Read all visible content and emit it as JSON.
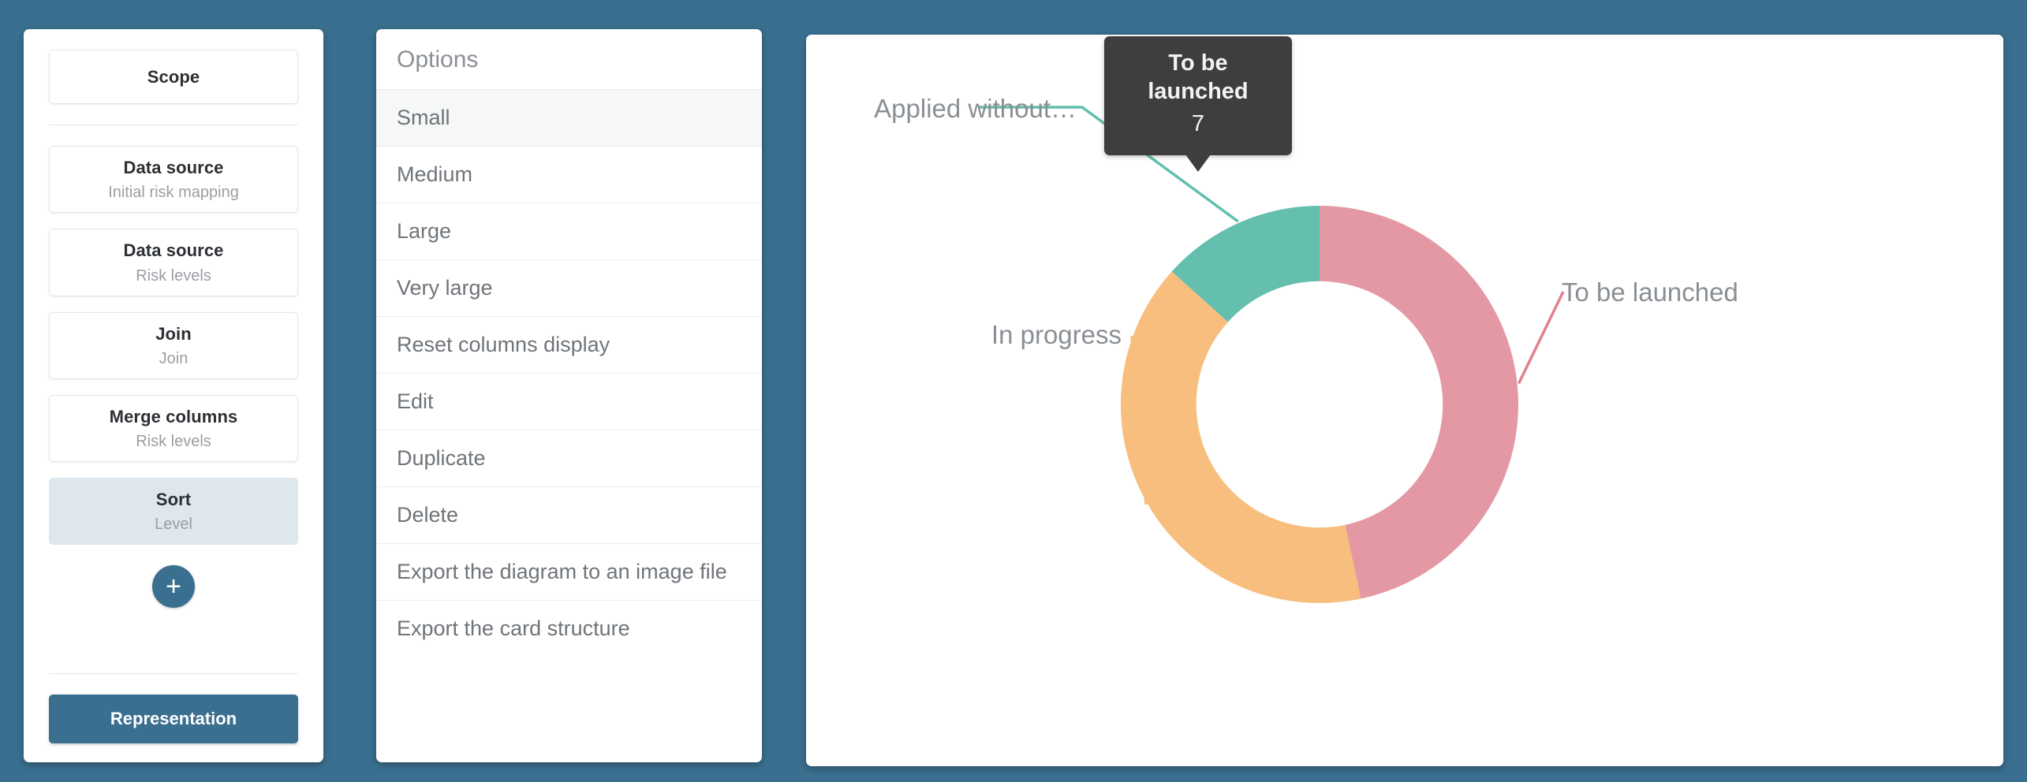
{
  "theme": {
    "background": "#3a6f8f",
    "accent": "#3a6f8f",
    "panel": "#ffffff",
    "selected_step": "#dde7ec",
    "tooltip_background": "#3e3e3e"
  },
  "pipeline": {
    "scope": {
      "title": "Scope"
    },
    "steps": [
      {
        "title": "Data source",
        "subtitle": "Initial risk mapping",
        "selected": false
      },
      {
        "title": "Data source",
        "subtitle": "Risk levels",
        "selected": false
      },
      {
        "title": "Join",
        "subtitle": "Join",
        "selected": false
      },
      {
        "title": "Merge columns",
        "subtitle": "Risk levels",
        "selected": false
      },
      {
        "title": "Sort",
        "subtitle": "Level",
        "selected": true
      }
    ],
    "add_step_label": "+",
    "representation_label": "Representation"
  },
  "options_menu": {
    "header": "Options",
    "items": [
      {
        "label": "Small",
        "highlighted": true
      },
      {
        "label": "Medium",
        "highlighted": false
      },
      {
        "label": "Large",
        "highlighted": false
      },
      {
        "label": "Very large",
        "highlighted": false
      },
      {
        "label": "Reset columns display",
        "highlighted": false
      },
      {
        "label": "Edit",
        "highlighted": false
      },
      {
        "label": "Duplicate",
        "highlighted": false
      },
      {
        "label": "Delete",
        "highlighted": false
      },
      {
        "label": "Export the diagram to an image file",
        "highlighted": false
      },
      {
        "label": "Export the card structure",
        "highlighted": false
      }
    ]
  },
  "tooltip": {
    "title": "To be launched",
    "value": "7"
  },
  "chart_data": {
    "type": "pie",
    "variant": "donut",
    "title": "",
    "categories": [
      "To be launched",
      "In progress",
      "Applied without…"
    ],
    "values": [
      7,
      6,
      2
    ],
    "total": 15,
    "colors": [
      "#e398a4",
      "#f7be7e",
      "#64bfae"
    ],
    "labels": [
      {
        "name": "To be launched",
        "value": 7,
        "color": "#e398a4",
        "position": "right"
      },
      {
        "name": "In progress",
        "value": 6,
        "color": "#f7be7e",
        "position": "left-bottom"
      },
      {
        "name": "Applied without…",
        "value": 2,
        "color": "#64bfae",
        "position": "left-top"
      }
    ],
    "start_angle_deg": 0,
    "direction": "clockwise",
    "inner_radius_ratio": 0.62,
    "legend": "leader-lines",
    "grid": false
  }
}
